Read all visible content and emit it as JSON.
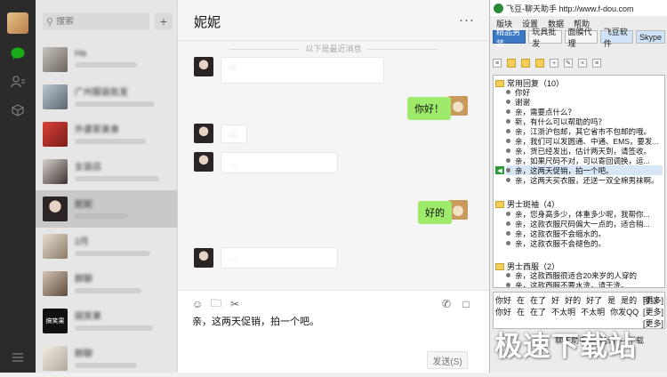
{
  "wechat": {
    "search_placeholder": "搜索",
    "add_label": "+",
    "sidebar_icons": [
      "chat-icon",
      "contacts-icon",
      "favorites-icon",
      "menu-icon"
    ],
    "conversations": [
      {
        "title": "Ha"
      },
      {
        "title": "广州服装批发"
      },
      {
        "title": "外婆家美食"
      },
      {
        "title": "女装店"
      },
      {
        "title": "妮妮"
      },
      {
        "title": "2月"
      },
      {
        "title": "群聊"
      },
      {
        "title": "搞笑果"
      },
      {
        "title": "群聊"
      }
    ],
    "conversation_badge": "搞笑果",
    "chat": {
      "title": "妮妮",
      "more_label": "···",
      "history_divider": "以下是最近消息",
      "messages": [
        {
          "side": "left",
          "text": "…"
        },
        {
          "side": "right",
          "text": "你好！"
        },
        {
          "side": "left",
          "text": "…"
        },
        {
          "side": "left",
          "kind": "file",
          "text": "…"
        },
        {
          "side": "right",
          "text": "好的"
        },
        {
          "side": "left",
          "kind": "file",
          "text": "…"
        }
      ],
      "draft": "亲，这两天促销，拍一个吧。",
      "send_label": "发送(S)"
    }
  },
  "helper": {
    "title": "飞豆-聊天助手 http://www.f-dou.com",
    "menu": [
      "版块",
      "设置",
      "数据",
      "帮助"
    ],
    "tabs": [
      {
        "label": "精品男装",
        "active": true
      },
      {
        "label": "玩具批发",
        "active": false
      },
      {
        "label": "面膜代理",
        "active": false
      },
      {
        "label": "飞豆软件",
        "active": false
      },
      {
        "label": "Skype",
        "active": false
      }
    ],
    "groups": [
      {
        "name": "常用回复（10）",
        "items": [
          "你好",
          "谢谢",
          "亲，需要点什么？",
          "新，有什么可以帮助的吗？",
          "亲，江浙沪包邮，其它省市不包邮的哦。",
          "亲，我们可以发圆通、中通、EMS，要发...",
          "亲，货已经发出，估计两天到，请签收。",
          "亲，如果尺码不对，可以寄回调换，运...",
          "亲，这两天促销，拍一个吧。",
          "亲，这两天买衣服，还送一双全棉男袜啊。"
        ],
        "selected_index": 8
      },
      {
        "name": "男士斑袖（4）",
        "items": [
          "亲，您身高多少，体重多少呢，我帮你...",
          "亲，这款衣服尺码偏大一点的，适合稍...",
          "亲，这款衣服不会缩水的。",
          "亲，这款衣服不会褪色的。"
        ]
      },
      {
        "name": "男士西服（2）",
        "items": [
          "亲，这款西服很适合20来岁的人穿的",
          "亲，这款西服不要水洗，请干洗。"
        ]
      }
    ],
    "quick_rows": [
      [
        "你好",
        "在",
        "在了",
        "好",
        "好的",
        "好了",
        "是",
        "是的",
        "可以"
      ],
      [
        "你好",
        "在",
        "在了",
        "不太明",
        "不太明",
        "你发QQ"
      ]
    ],
    "more_label": "[更多]",
    "bottom_hint": "聊天助手 — 电话 — 下载"
  },
  "watermark": "极速下载站"
}
